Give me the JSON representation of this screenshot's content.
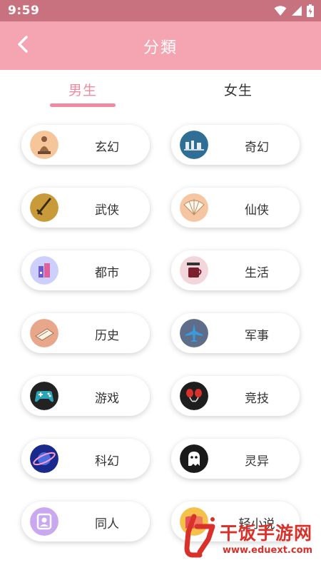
{
  "status_bar": {
    "time": "9:59"
  },
  "header": {
    "title": "分類"
  },
  "tabs": {
    "male": "男生",
    "female": "女生",
    "active": "male"
  },
  "categories": [
    {
      "label": "玄幻",
      "icon": "buddha-statue-icon"
    },
    {
      "label": "奇幻",
      "icon": "fantasy-scene-icon"
    },
    {
      "label": "武侠",
      "icon": "sword-icon"
    },
    {
      "label": "仙侠",
      "icon": "folding-fan-icon"
    },
    {
      "label": "都市",
      "icon": "city-buildings-icon"
    },
    {
      "label": "生活",
      "icon": "coffee-cup-icon"
    },
    {
      "label": "历史",
      "icon": "scroll-book-icon"
    },
    {
      "label": "军事",
      "icon": "fighter-jet-icon"
    },
    {
      "label": "游戏",
      "icon": "gamepad-icon"
    },
    {
      "label": "竞技",
      "icon": "boxing-gloves-icon"
    },
    {
      "label": "科幻",
      "icon": "planet-icon"
    },
    {
      "label": "灵异",
      "icon": "ghost-icon"
    },
    {
      "label": "同人",
      "icon": "portrait-frame-icon"
    },
    {
      "label": "轻小说",
      "icon": "open-book-icon"
    }
  ],
  "watermark": {
    "name": "干饭手游网",
    "url": "www.eduext.com"
  },
  "colors": {
    "status_bar": "#c9727f",
    "app_bar": "#f5a4b1",
    "accent": "#f08aa0"
  }
}
